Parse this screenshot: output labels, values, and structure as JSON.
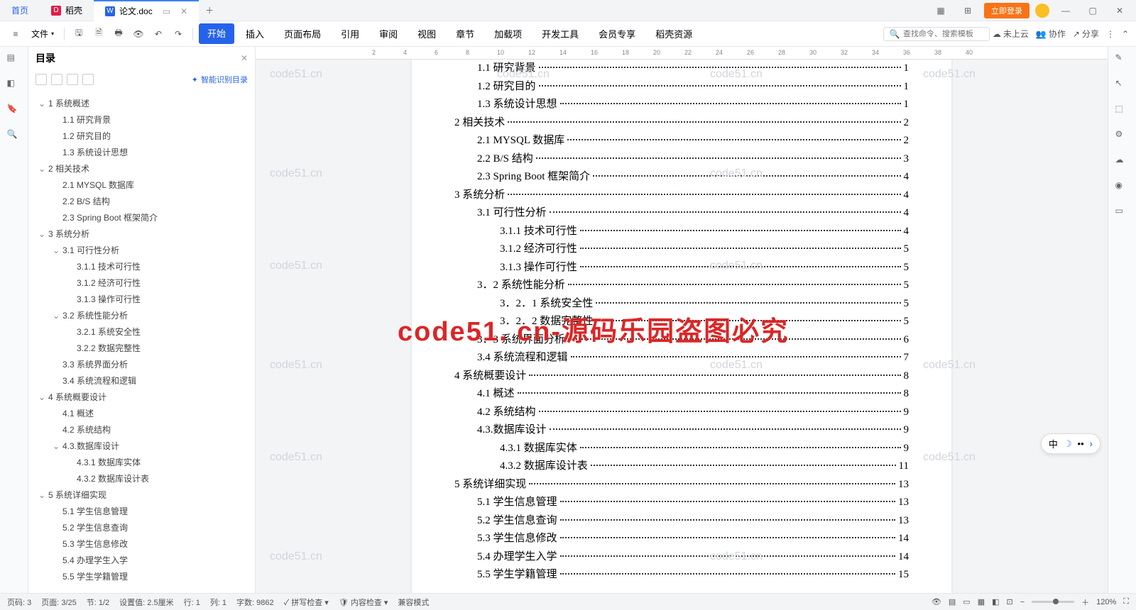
{
  "titlebar": {
    "tabs": [
      {
        "label": "首页",
        "icon": "home"
      },
      {
        "label": "稻壳",
        "icon": "docer"
      },
      {
        "label": "论文.doc",
        "icon": "word",
        "active": true
      }
    ],
    "login": "立即登录"
  },
  "menubar": {
    "file": "文件",
    "tabs": [
      "开始",
      "插入",
      "页面布局",
      "引用",
      "审阅",
      "视图",
      "章节",
      "加载项",
      "开发工具",
      "会员专享",
      "稻壳资源"
    ],
    "active_tab": "开始",
    "search_placeholder": "查找命令、搜索模板",
    "cloud": "未上云",
    "collab": "协作",
    "share": "分享"
  },
  "outline": {
    "title": "目录",
    "smart": "智能识别目录",
    "tree": [
      {
        "l": 1,
        "t": "1 系统概述",
        "exp": true
      },
      {
        "l": 2,
        "t": "1.1 研究背景"
      },
      {
        "l": 2,
        "t": "1.2 研究目的"
      },
      {
        "l": 2,
        "t": "1.3 系统设计思想"
      },
      {
        "l": 1,
        "t": "2 相关技术",
        "exp": true
      },
      {
        "l": 2,
        "t": "2.1 MYSQL 数据库"
      },
      {
        "l": 2,
        "t": "2.2 B/S 结构"
      },
      {
        "l": 2,
        "t": "2.3 Spring Boot 框架简介"
      },
      {
        "l": 1,
        "t": "3 系统分析",
        "exp": true
      },
      {
        "l": 2,
        "t": "3.1 可行性分析",
        "exp": true
      },
      {
        "l": 3,
        "t": "3.1.1 技术可行性"
      },
      {
        "l": 3,
        "t": "3.1.2 经济可行性"
      },
      {
        "l": 3,
        "t": "3.1.3 操作可行性"
      },
      {
        "l": 2,
        "t": "3.2 系统性能分析",
        "exp": true
      },
      {
        "l": 3,
        "t": "3.2.1 系统安全性"
      },
      {
        "l": 3,
        "t": "3.2.2 数据完整性"
      },
      {
        "l": 2,
        "t": "3.3 系统界面分析"
      },
      {
        "l": 2,
        "t": "3.4 系统流程和逻辑"
      },
      {
        "l": 1,
        "t": "4 系统概要设计",
        "exp": true
      },
      {
        "l": 2,
        "t": "4.1 概述"
      },
      {
        "l": 2,
        "t": "4.2 系统结构"
      },
      {
        "l": 2,
        "t": "4.3.数据库设计",
        "exp": true
      },
      {
        "l": 3,
        "t": "4.3.1 数据库实体"
      },
      {
        "l": 3,
        "t": "4.3.2 数据库设计表"
      },
      {
        "l": 1,
        "t": "5 系统详细实现",
        "exp": true
      },
      {
        "l": 2,
        "t": "5.1 学生信息管理"
      },
      {
        "l": 2,
        "t": "5.2 学生信息查询"
      },
      {
        "l": 2,
        "t": "5.3 学生信息修改"
      },
      {
        "l": 2,
        "t": "5.4 办理学生入学"
      },
      {
        "l": 2,
        "t": "5.5 学生学籍管理"
      }
    ]
  },
  "toc": [
    {
      "l": 2,
      "t": "1.1 研究背景",
      "p": "1"
    },
    {
      "l": 2,
      "t": "1.2 研究目的",
      "p": "1"
    },
    {
      "l": 2,
      "t": "1.3 系统设计思想",
      "p": "1"
    },
    {
      "l": 1,
      "t": "2 相关技术",
      "p": "2"
    },
    {
      "l": 2,
      "t": "2.1 MYSQL 数据库",
      "p": "2"
    },
    {
      "l": 2,
      "t": "2.2 B/S 结构",
      "p": "3"
    },
    {
      "l": 2,
      "t": "2.3 Spring Boot 框架简介",
      "p": "4"
    },
    {
      "l": 1,
      "t": "3 系统分析",
      "p": "4"
    },
    {
      "l": 2,
      "t": "3.1 可行性分析",
      "p": "4"
    },
    {
      "l": 3,
      "t": "3.1.1 技术可行性",
      "p": "4"
    },
    {
      "l": 3,
      "t": "3.1.2 经济可行性",
      "p": "5"
    },
    {
      "l": 3,
      "t": "3.1.3 操作可行性",
      "p": "5"
    },
    {
      "l": 2,
      "t": "3．2 系统性能分析",
      "p": "5"
    },
    {
      "l": 3,
      "t": "3．2．1 系统安全性",
      "p": "5"
    },
    {
      "l": 3,
      "t": "3．2．2 数据完整性",
      "p": "5"
    },
    {
      "l": 2,
      "t": "3．3 系统界面分析",
      "p": "6"
    },
    {
      "l": 2,
      "t": "3.4 系统流程和逻辑",
      "p": "7"
    },
    {
      "l": 1,
      "t": "4 系统概要设计",
      "p": "8"
    },
    {
      "l": 2,
      "t": "4.1 概述",
      "p": "8"
    },
    {
      "l": 2,
      "t": "4.2 系统结构",
      "p": "9"
    },
    {
      "l": 2,
      "t": "4.3.数据库设计",
      "p": "9"
    },
    {
      "l": 3,
      "t": "4.3.1 数据库实体",
      "p": "9"
    },
    {
      "l": 3,
      "t": "4.3.2 数据库设计表",
      "p": "11"
    },
    {
      "l": 1,
      "t": "5 系统详细实现",
      "p": "13"
    },
    {
      "l": 2,
      "t": "5.1  学生信息管理",
      "p": "13"
    },
    {
      "l": 2,
      "t": "5.2  学生信息查询",
      "p": "13"
    },
    {
      "l": 2,
      "t": "5.3  学生信息修改",
      "p": "14"
    },
    {
      "l": 2,
      "t": "5.4  办理学生入学",
      "p": "14"
    },
    {
      "l": 2,
      "t": "5.5  学生学籍管理",
      "p": "15"
    }
  ],
  "statusbar": {
    "page_no": "页码: 3",
    "page": "页面: 3/25",
    "section": "节: 1/2",
    "setting": "设置值: 2.5厘米",
    "row": "行: 1",
    "col": "列: 1",
    "words": "字数: 9862",
    "spell": "拼写检查",
    "content": "内容检查",
    "compat": "兼容模式",
    "zoom": "120%"
  },
  "watermarks": {
    "text": "code51.cn",
    "big": "code51. cn-源码乐园盗图必究"
  },
  "ime": {
    "ch": "中"
  }
}
